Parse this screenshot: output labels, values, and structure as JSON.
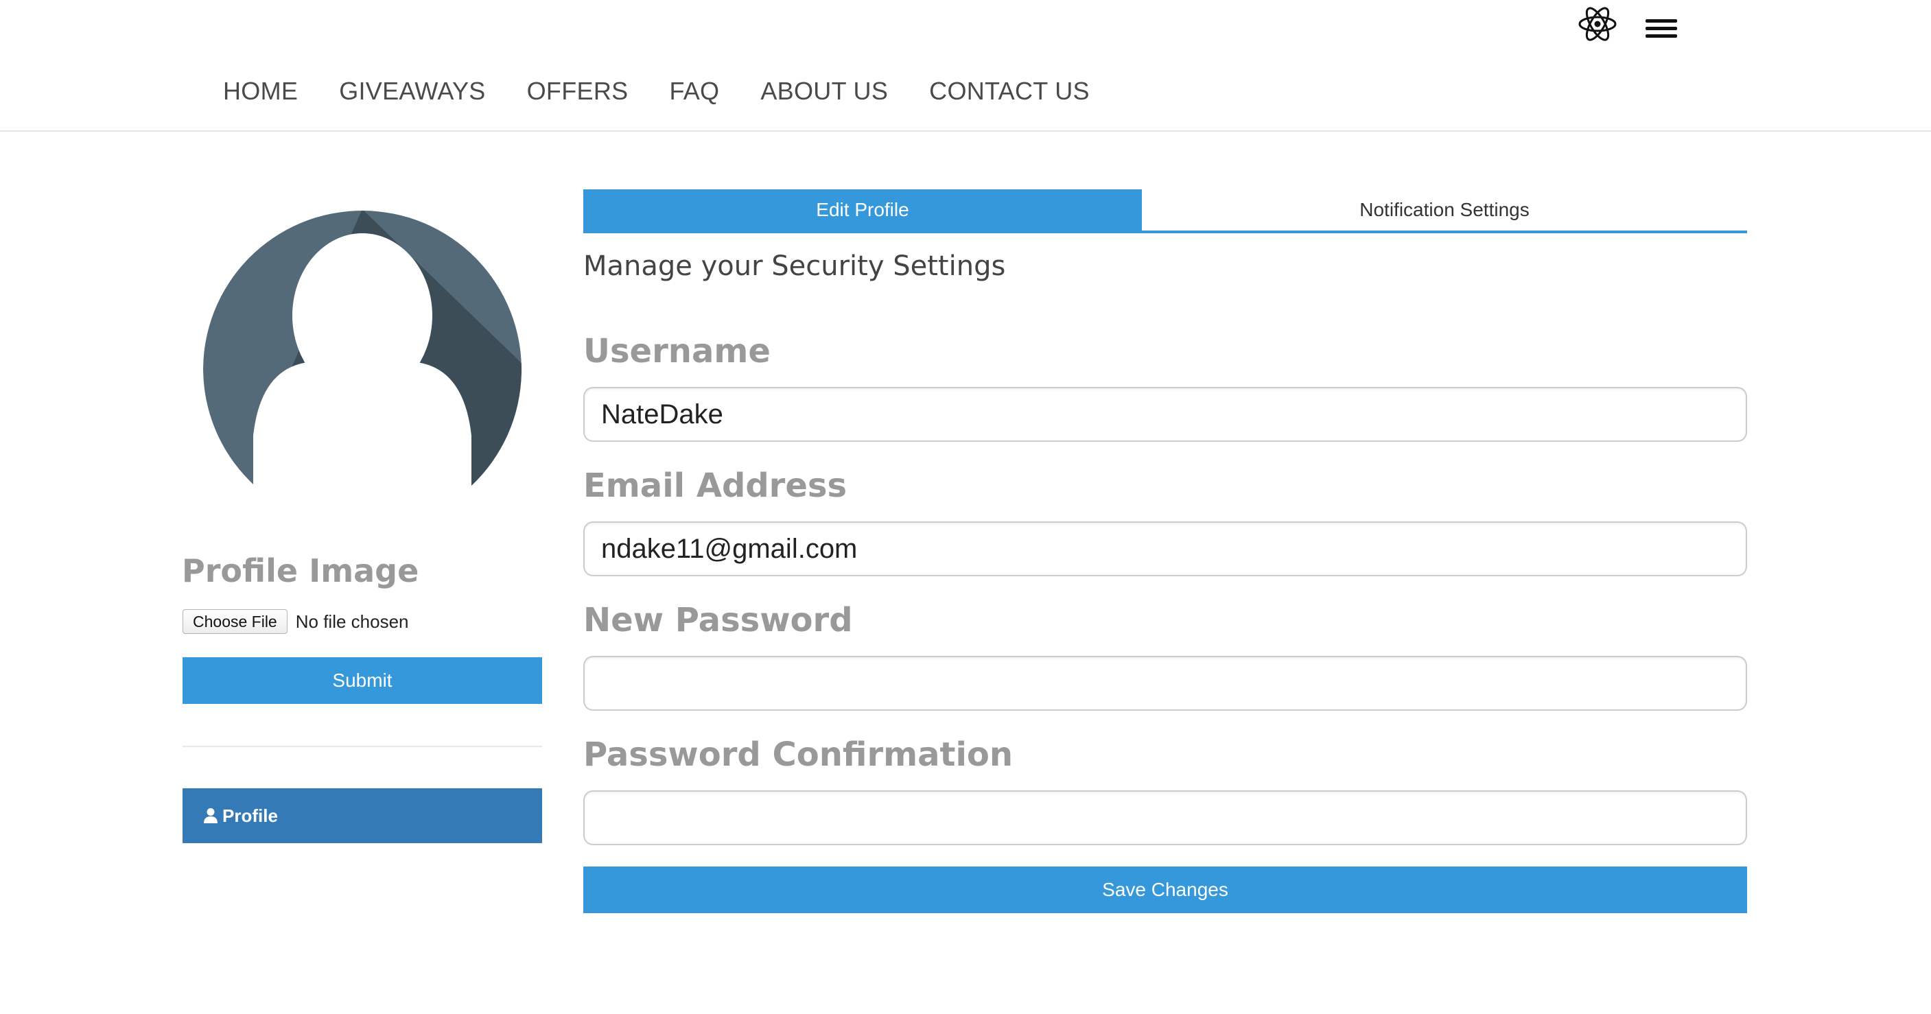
{
  "header": {
    "nav": [
      "HOME",
      "GIVEAWAYS",
      "OFFERS",
      "FAQ",
      "ABOUT US",
      "CONTACT US"
    ],
    "icons": [
      "react-atom-icon",
      "hamburger-menu-icon"
    ]
  },
  "sidebar": {
    "profile_image_heading": "Profile Image",
    "choose_file_label": "Choose File",
    "file_status": "No file chosen",
    "submit_label": "Submit",
    "profile_link_label": "Profile",
    "profile_link_icon": "user-icon"
  },
  "main": {
    "tabs": [
      {
        "label": "Edit Profile",
        "active": true
      },
      {
        "label": "Notification Settings",
        "active": false
      }
    ],
    "section_title": "Manage your Security Settings",
    "fields": {
      "username": {
        "label": "Username",
        "value": "NateDake"
      },
      "email": {
        "label": "Email Address",
        "value": "ndake11@gmail.com"
      },
      "new_password": {
        "label": "New Password",
        "value": ""
      },
      "password_confirmation": {
        "label": "Password Confirmation",
        "value": ""
      }
    },
    "save_label": "Save Changes"
  },
  "colors": {
    "primary": "#3498db",
    "sidebar_active": "#337ab7",
    "label_gray": "#999999",
    "avatar_dark": "#546a79",
    "avatar_shadow": "#3d4d58"
  }
}
